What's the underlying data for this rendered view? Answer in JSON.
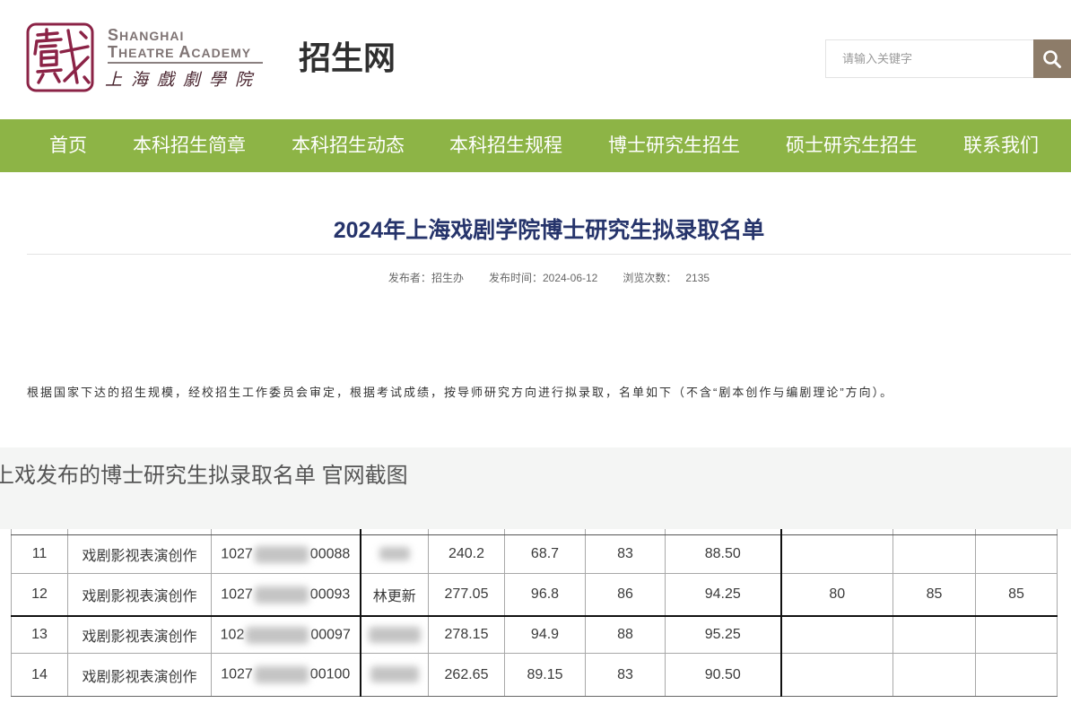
{
  "header": {
    "logo": {
      "en_line1": "SHANGHAI",
      "en_line2": [
        "THEATRE",
        "ACADEMY"
      ],
      "cn": "上海戲劇學院",
      "color": "#8b2346"
    },
    "site_title": "招生网",
    "search": {
      "placeholder": "请输入关键字",
      "value": "",
      "button_icon": "search-icon",
      "button_color": "#8d7c69"
    }
  },
  "nav": {
    "background": "#8db446",
    "items": [
      {
        "label": "首页"
      },
      {
        "label": "本科招生简章"
      },
      {
        "label": "本科招生动态"
      },
      {
        "label": "本科招生规程"
      },
      {
        "label": "博士研究生招生"
      },
      {
        "label": "硕士研究生招生"
      },
      {
        "label": "联系我们"
      }
    ]
  },
  "article": {
    "title": "2024年上海戏剧学院博士研究生拟录取名单",
    "title_color": "#26346b",
    "meta": {
      "publisher_label": "发布者：",
      "publisher": "招生办",
      "date_label": "发布时间：",
      "date": "2024-06-12",
      "views_label": "浏览次数：",
      "views": "2135"
    },
    "intro": "根据国家下达的招生规模，经校招生工作委员会审定，根据考试成绩，按导师研究方向进行拟录取，名单如下（不含“剧本创作与编剧理论”方向）。"
  },
  "caption": "上戏发布的博士研究生拟录取名单 官网截图",
  "table": {
    "rows": [
      {
        "no": "11",
        "major": "戏剧影视表演创作",
        "id_prefix": "1027",
        "id_suffix": "00088",
        "score_1": "240.2",
        "score_2": "68.7",
        "score_3": "83",
        "score_4": "88.50"
      },
      {
        "no": "12",
        "major": "戏剧影视表演创作",
        "id_prefix": "1027",
        "id_suffix": "00093",
        "name": "林更新",
        "score_1": "277.05",
        "score_2": "96.8",
        "score_3": "86",
        "score_4": "94.25",
        "score_5": "80",
        "score_6": "85",
        "score_7": "85"
      },
      {
        "no": "13",
        "major": "戏剧影视表演创作",
        "id_prefix": "102",
        "id_suffix": "00097",
        "score_1": "278.15",
        "score_2": "94.9",
        "score_3": "88",
        "score_4": "95.25"
      },
      {
        "no": "14",
        "major": "戏剧影视表演创作",
        "id_prefix": "1027",
        "id_suffix": "00100",
        "score_1": "262.65",
        "score_2": "89.15",
        "score_3": "83",
        "score_4": "90.50"
      }
    ]
  }
}
